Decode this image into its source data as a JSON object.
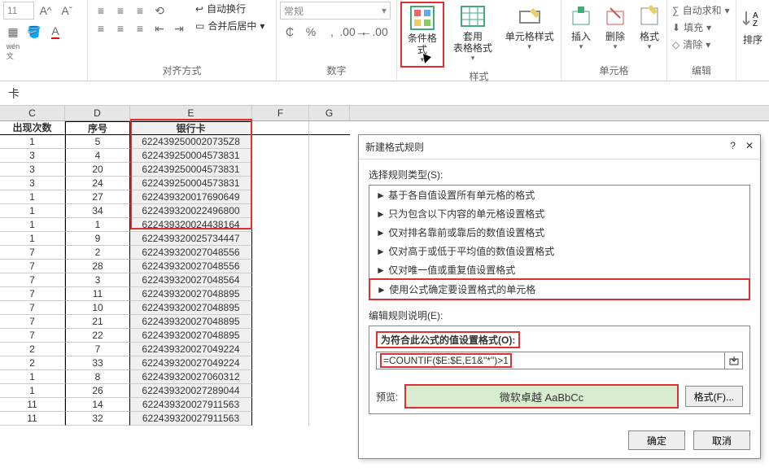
{
  "ribbon": {
    "font": {
      "label": "",
      "fontsize_placeholder": "11"
    },
    "align": {
      "label": "对齐方式",
      "wrap": "自动换行",
      "merge": "合并后居中"
    },
    "number": {
      "label": "数字",
      "category": "常规"
    },
    "styles": {
      "label": "样式",
      "cond_fmt": "条件格式",
      "table_fmt": "套用\n表格格式",
      "cell_styles": "单元格样式"
    },
    "cells": {
      "label": "单元格",
      "insert": "插入",
      "delete": "删除",
      "format": "格式"
    },
    "edit": {
      "label": "编辑",
      "autosum": "自动求和",
      "fill": "填充",
      "clear": "清除",
      "sort": "排序"
    }
  },
  "fbar": {
    "text": "卡"
  },
  "columns": {
    "C": "C",
    "D": "D",
    "E": "E",
    "F": "F",
    "G": "G"
  },
  "headers": {
    "C": "出现次数",
    "D": "序号",
    "E": "银行卡"
  },
  "rows": [
    {
      "c": "1",
      "d": "5",
      "e": "6224392500020735Z8"
    },
    {
      "c": "3",
      "d": "4",
      "e": "622439250004573831"
    },
    {
      "c": "3",
      "d": "20",
      "e": "622439250004573831"
    },
    {
      "c": "3",
      "d": "24",
      "e": "622439250004573831"
    },
    {
      "c": "1",
      "d": "27",
      "e": "622439320017690649"
    },
    {
      "c": "1",
      "d": "34",
      "e": "622439320022496800"
    },
    {
      "c": "1",
      "d": "1",
      "e": "622439320024438164"
    },
    {
      "c": "1",
      "d": "9",
      "e": "622439320025734447"
    },
    {
      "c": "7",
      "d": "2",
      "e": "622439320027048556"
    },
    {
      "c": "7",
      "d": "28",
      "e": "622439320027048556"
    },
    {
      "c": "7",
      "d": "3",
      "e": "622439320027048564"
    },
    {
      "c": "7",
      "d": "11",
      "e": "622439320027048895"
    },
    {
      "c": "7",
      "d": "10",
      "e": "622439320027048895"
    },
    {
      "c": "7",
      "d": "21",
      "e": "622439320027048895"
    },
    {
      "c": "7",
      "d": "22",
      "e": "622439320027048895"
    },
    {
      "c": "2",
      "d": "7",
      "e": "622439320027049224"
    },
    {
      "c": "2",
      "d": "33",
      "e": "622439320027049224"
    },
    {
      "c": "1",
      "d": "8",
      "e": "622439320027060312"
    },
    {
      "c": "1",
      "d": "26",
      "e": "622439320027289044"
    },
    {
      "c": "11",
      "d": "14",
      "e": "622439320027911563"
    },
    {
      "c": "11",
      "d": "32",
      "e": "622439320027911563"
    }
  ],
  "dialog": {
    "title": "新建格式规则",
    "select_label": "选择规则类型(S):",
    "rules": [
      "基于各自值设置所有单元格的格式",
      "只为包含以下内容的单元格设置格式",
      "仅对排名靠前或靠后的数值设置格式",
      "仅对高于或低于平均值的数值设置格式",
      "仅对唯一值或重复值设置格式",
      "使用公式确定要设置格式的单元格"
    ],
    "edit_label": "编辑规则说明(E):",
    "formula_title": "为符合此公式的值设置格式(O):",
    "formula": "=COUNTIF($E:$E,E1&\"*\")>1",
    "preview_label": "预览:",
    "preview_text": "微软卓越 AaBbCc",
    "format_btn": "格式(F)...",
    "ok": "确定",
    "cancel": "取消",
    "help": "?",
    "close": "✕"
  }
}
